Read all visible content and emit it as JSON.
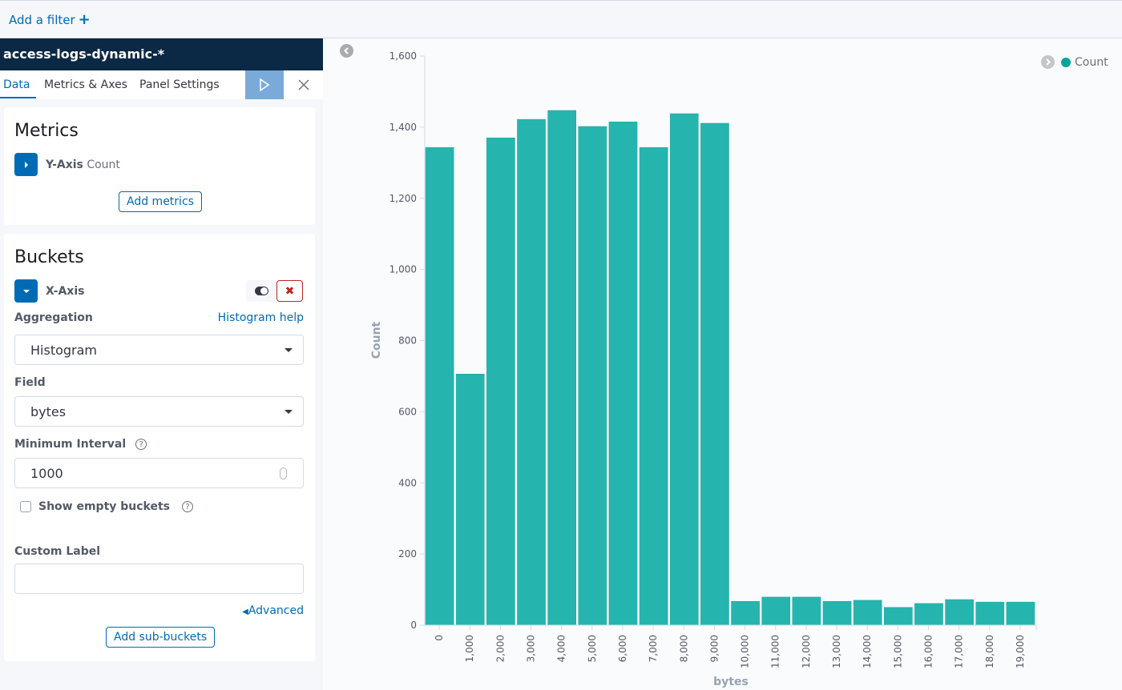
{
  "filter_bar": {
    "add_filter_label": "Add a filter",
    "add_filter_icon": "plus-icon"
  },
  "sidebar": {
    "index_pattern": "access-logs-dynamic-*",
    "tabs": [
      {
        "label": "Data",
        "active": true
      },
      {
        "label": "Metrics & Axes",
        "active": false
      },
      {
        "label": "Panel Settings",
        "active": false
      }
    ],
    "apply_icon": "play-icon",
    "discard_icon": "close-icon",
    "metrics": {
      "title": "Metrics",
      "items": [
        {
          "axis": "Y-Axis",
          "agg": "Count",
          "expanded": false
        }
      ],
      "add_button": "Add metrics"
    },
    "buckets": {
      "title": "Buckets",
      "item": {
        "axis": "X-Axis",
        "expanded": true
      },
      "aggregation_label": "Aggregation",
      "aggregation_help": "Histogram help",
      "aggregation_value": "Histogram",
      "field_label": "Field",
      "field_value": "bytes",
      "interval_label": "Minimum Interval",
      "interval_value": "1000",
      "show_empty_label": "Show empty buckets",
      "show_empty_checked": false,
      "custom_label_label": "Custom Label",
      "custom_label_value": "",
      "advanced_link": "Advanced",
      "add_button": "Add sub-buckets",
      "help_glyph": "?"
    }
  },
  "colors": {
    "accent": "#006bb4",
    "series": "#00a69b",
    "bar_fill": "#26b5ae",
    "header_bg": "#0b2845",
    "danger": "#bd271e"
  },
  "chart_data": {
    "type": "bar",
    "title": "",
    "xlabel": "bytes",
    "ylabel": "Count",
    "ylim": [
      0,
      1600
    ],
    "yticks": [
      0,
      200,
      400,
      600,
      800,
      1000,
      1200,
      1400,
      1600
    ],
    "ytick_labels": [
      "0",
      "200",
      "400",
      "600",
      "800",
      "1,000",
      "1,200",
      "1,400",
      "1,600"
    ],
    "categories": [
      "0",
      "1,000",
      "2,000",
      "3,000",
      "4,000",
      "5,000",
      "6,000",
      "7,000",
      "8,000",
      "9,000",
      "10,000",
      "11,000",
      "12,000",
      "13,000",
      "14,000",
      "15,000",
      "16,000",
      "17,000",
      "18,000",
      "19,000"
    ],
    "series": [
      {
        "name": "Count",
        "values": [
          1343,
          706,
          1370,
          1422,
          1447,
          1402,
          1415,
          1343,
          1438,
          1411,
          67,
          79,
          79,
          67,
          70,
          50,
          61,
          72,
          65,
          65
        ]
      }
    ],
    "legend": {
      "position": "top-right",
      "entries": [
        "Count"
      ]
    },
    "grid": false
  }
}
